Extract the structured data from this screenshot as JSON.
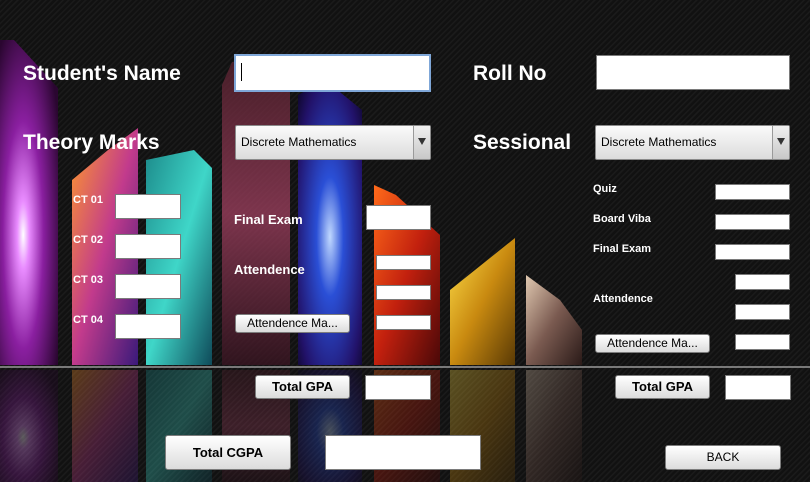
{
  "labels": {
    "student_name": "Student's Name",
    "roll_no": "Roll No",
    "theory_marks": "Theory Marks",
    "sessional": "Sessional",
    "ct01": "CT 01",
    "ct02": "CT 02",
    "ct03": "CT 03",
    "ct04": "CT 04",
    "final_exam_theory": "Final Exam",
    "attendence_theory": "Attendence",
    "quiz": "Quiz",
    "board_viba": "Board Viba",
    "final_exam_sessional": "Final Exam",
    "attendence_sessional": "Attendence"
  },
  "combos": {
    "theory_subject": "Discrete Mathematics",
    "sessional_subject": "Discrete Mathematics"
  },
  "buttons": {
    "attendence_theory": "Attendence Ma...",
    "attendence_sessional": "Attendence Ma...",
    "total_gpa_theory": "Total GPA",
    "total_gpa_sessional": "Total GPA",
    "total_cgpa": "Total CGPA",
    "back": "BACK"
  },
  "colors": {
    "background": "#141414",
    "label_text": "#ffffff",
    "focus_border": "#7fa7d8"
  }
}
